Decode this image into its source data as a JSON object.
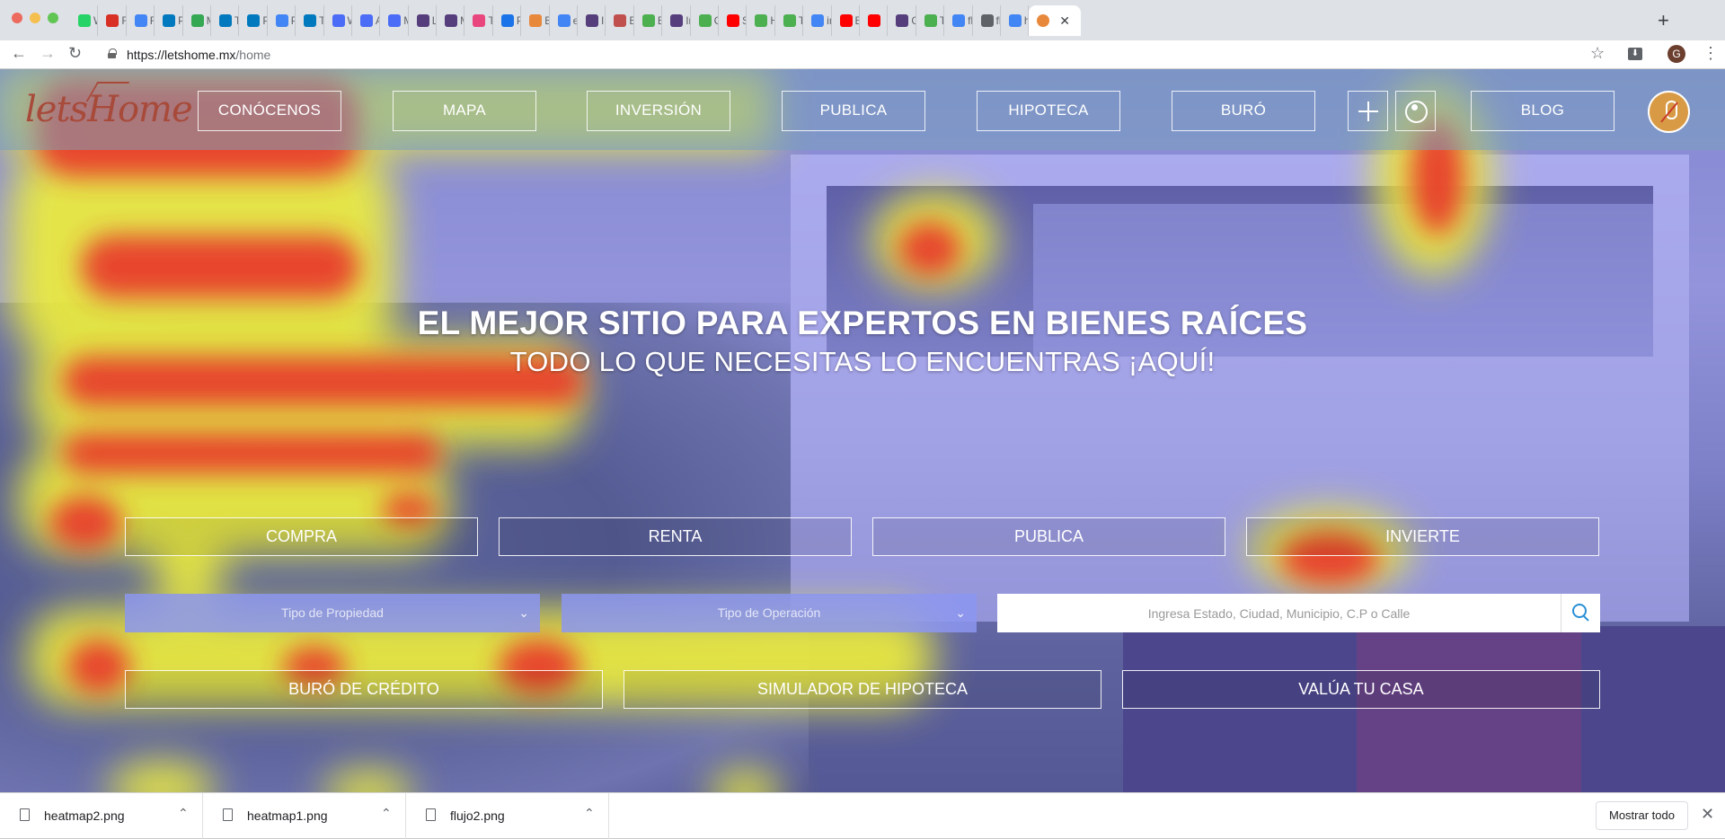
{
  "browser": {
    "tabs": [
      {
        "label": "W",
        "icon": "whatsapp-icon",
        "color": "#25d366"
      },
      {
        "label": "Re",
        "icon": "gmail-icon",
        "color": "#d93025"
      },
      {
        "label": "Fo",
        "icon": "docs-icon",
        "color": "#4285f4"
      },
      {
        "label": "Pl",
        "icon": "trello-icon",
        "color": "#0079bf"
      },
      {
        "label": "M",
        "icon": "drive-icon",
        "color": "#34a853"
      },
      {
        "label": "Ti",
        "icon": "trello-icon",
        "color": "#0079bf"
      },
      {
        "label": "Pl",
        "icon": "trello-icon",
        "color": "#0079bf"
      },
      {
        "label": "Pr",
        "icon": "docs-icon",
        "color": "#4285f4"
      },
      {
        "label": "Te",
        "icon": "trello-icon",
        "color": "#0079bf"
      },
      {
        "label": "W",
        "icon": "link-icon",
        "color": "#4a6cf7"
      },
      {
        "label": "Al",
        "icon": "link-icon",
        "color": "#4a6cf7"
      },
      {
        "label": "M",
        "icon": "link-icon",
        "color": "#4a6cf7"
      },
      {
        "label": "Li",
        "icon": "bootstrap-icon",
        "color": "#563d7c"
      },
      {
        "label": "M",
        "icon": "bootstrap-icon",
        "color": "#563d7c"
      },
      {
        "label": "Tl",
        "icon": "u-icon",
        "color": "#e8467c"
      },
      {
        "label": "Pr",
        "icon": "ux-icon",
        "color": "#1a73e8"
      },
      {
        "label": "Bi",
        "icon": "letshome-icon",
        "color": "#e8883a"
      },
      {
        "label": "el",
        "icon": "google-icon",
        "color": "#4285f4"
      },
      {
        "label": "In",
        "icon": "bootstrap-icon",
        "color": "#563d7c"
      },
      {
        "label": "Bi",
        "icon": "chrome-icon",
        "color": "#c0504d"
      },
      {
        "label": "Bi",
        "icon": "w3-icon",
        "color": "#4caf50"
      },
      {
        "label": "In",
        "icon": "bootstrap-icon",
        "color": "#563d7c"
      },
      {
        "label": "Cl",
        "icon": "w3-icon",
        "color": "#4caf50"
      },
      {
        "label": "St",
        "icon": "youtube-icon",
        "color": "#ff0000"
      },
      {
        "label": "H",
        "icon": "w3-icon",
        "color": "#4caf50"
      },
      {
        "label": "Tr",
        "icon": "w3-icon",
        "color": "#4caf50"
      },
      {
        "label": "in",
        "icon": "google-icon",
        "color": "#4285f4"
      },
      {
        "label": "Bi",
        "icon": "youtube-icon",
        "color": "#ff0000"
      },
      {
        "label": "",
        "icon": "youtube-icon",
        "color": "#ff0000"
      },
      {
        "label": "G",
        "icon": "bootstrap-icon",
        "color": "#563d7c"
      },
      {
        "label": "Tr",
        "icon": "w3-icon",
        "color": "#4caf50"
      },
      {
        "label": "flu",
        "icon": "google-icon",
        "color": "#4285f4"
      },
      {
        "label": "flu",
        "icon": "file-icon",
        "color": "#5f6368"
      },
      {
        "label": "he",
        "icon": "google-icon",
        "color": "#4285f4"
      }
    ],
    "active_tab": {
      "icon": "letshome-icon",
      "color": "#e8883a",
      "close": "✕"
    },
    "new_tab": "+",
    "url_host": "https://letshome.mx",
    "url_path": "/home",
    "profile_initial": "G"
  },
  "header": {
    "logo_text": "letsHome",
    "nav": [
      "CONÓCENOS",
      "MAPA",
      "INVERSIÓN",
      "PUBLICA",
      "HIPOTECA",
      "BURÓ"
    ],
    "blog": "BLOG"
  },
  "hero": {
    "headline": "EL MEJOR SITIO PARA EXPERTOS EN BIENES RAÍCES",
    "subheadline": "TODO LO QUE NECESITAS LO ENCUENTRAS ¡AQUÍ!"
  },
  "mode_buttons": [
    "COMPRA",
    "RENTA",
    "PUBLICA",
    "INVIERTE"
  ],
  "search": {
    "property_type_placeholder": "Tipo de Propiedad",
    "operation_type_placeholder": "Tipo de Operación",
    "location_placeholder": "Ingresa Estado, Ciudad, Municipio, C.P o Calle"
  },
  "tools": [
    "BURÓ DE CRÉDITO",
    "SIMULADOR DE HIPOTECA",
    "VALÚA TU CASA"
  ],
  "downloads": {
    "items": [
      "heatmap2.png",
      "heatmap1.png",
      "flujo2.png"
    ],
    "show_all": "Mostrar todo"
  },
  "colors": {
    "heat_red": "#e8342c",
    "heat_yellow": "#ecec3c",
    "heat_blue": "#6e6cf2",
    "brand": "#a84a3a"
  }
}
